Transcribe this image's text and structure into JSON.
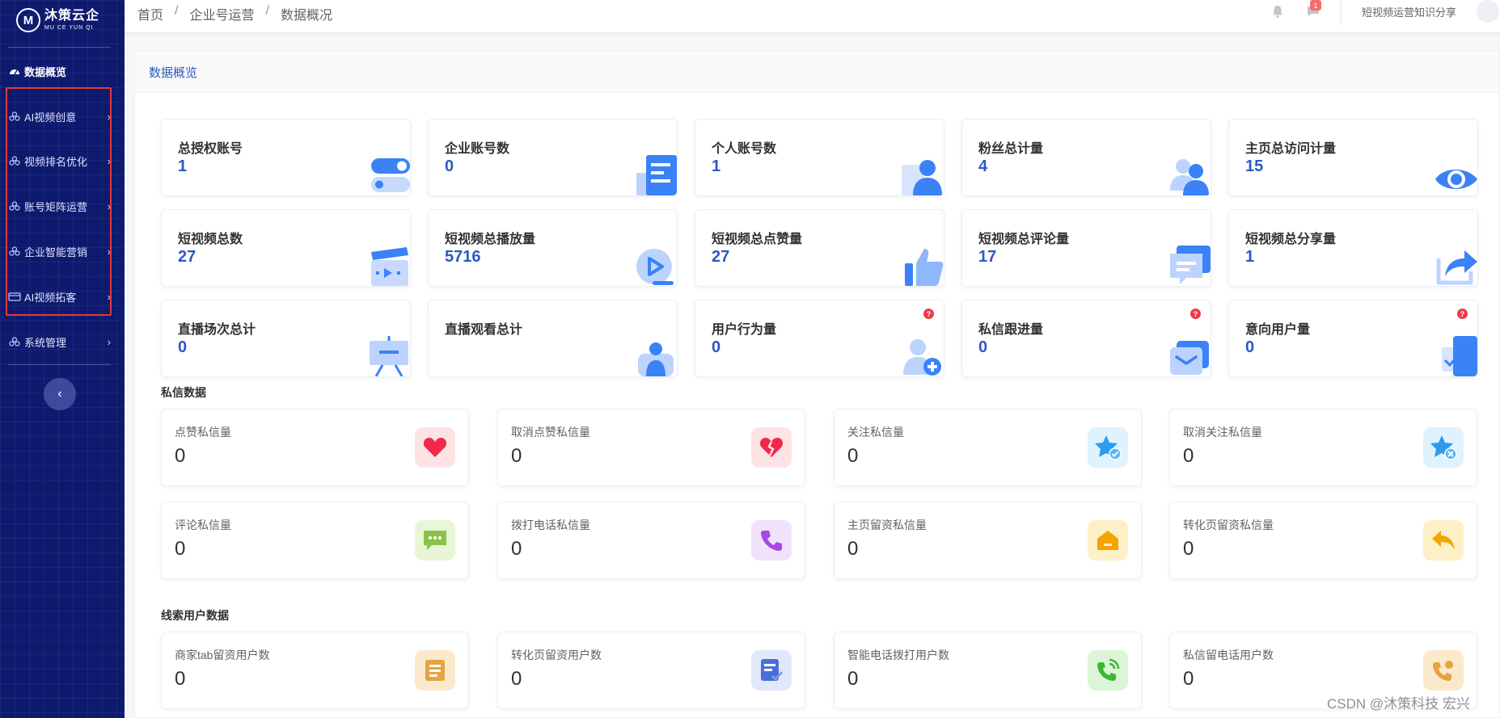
{
  "brand": {
    "cn": "沐策云企",
    "en": "MU CE YUN QI",
    "mark": "M"
  },
  "sidebar": {
    "items": [
      {
        "label": "数据概览"
      },
      {
        "label": "AI视频创意"
      },
      {
        "label": "视频排名优化"
      },
      {
        "label": "账号矩阵运营"
      },
      {
        "label": "企业智能营销"
      },
      {
        "label": "AI视频拓客"
      },
      {
        "label": "系统管理"
      }
    ],
    "collapse_glyph": "‹"
  },
  "header": {
    "breadcrumb": [
      "首页",
      "企业号运营",
      "数据概况"
    ],
    "separator": "/",
    "notification_count": "1",
    "user": "短视频运营知识分享"
  },
  "panel": {
    "title": "数据概览"
  },
  "stats": [
    {
      "label": "总授权账号",
      "value": "1",
      "icon": "toggle-icon"
    },
    {
      "label": "企业账号数",
      "value": "0",
      "icon": "document-icon"
    },
    {
      "label": "个人账号数",
      "value": "1",
      "icon": "user-icon"
    },
    {
      "label": "粉丝总计量",
      "value": "4",
      "icon": "users-icon"
    },
    {
      "label": "主页总访问计量",
      "value": "15",
      "icon": "eye-icon"
    },
    {
      "label": "短视频总数",
      "value": "27",
      "icon": "clapperboard-icon"
    },
    {
      "label": "短视频总播放量",
      "value": "5716",
      "icon": "play-icon"
    },
    {
      "label": "短视频总点赞量",
      "value": "27",
      "icon": "thumbs-up-icon"
    },
    {
      "label": "短视频总评论量",
      "value": "17",
      "icon": "comment-icon"
    },
    {
      "label": "短视频总分享量",
      "value": "1",
      "icon": "share-icon"
    },
    {
      "label": "直播场次总计",
      "value": "0",
      "icon": "easel-icon"
    },
    {
      "label": "直播观看总计",
      "value": "",
      "icon": "viewer-icon"
    },
    {
      "label": "用户行为量",
      "value": "0",
      "icon": "user-add-icon",
      "help": "?"
    },
    {
      "label": "私信跟进量",
      "value": "0",
      "icon": "message-icon",
      "help": "?"
    },
    {
      "label": "意向用户量",
      "value": "0",
      "icon": "checklist-icon",
      "help": "?"
    }
  ],
  "sections": {
    "private_messages": "私信数据",
    "leads": "线索用户数据"
  },
  "private_messages": [
    {
      "label": "点赞私信量",
      "value": "0",
      "icon": "heart-icon",
      "color": "#f0284a",
      "bg": "#fde2e6"
    },
    {
      "label": "取消点赞私信量",
      "value": "0",
      "icon": "broken-heart-icon",
      "color": "#f0284a",
      "bg": "#fde2e6"
    },
    {
      "label": "关注私信量",
      "value": "0",
      "icon": "star-check-icon",
      "color": "#2d9cf0",
      "bg": "#dff2fd"
    },
    {
      "label": "取消关注私信量",
      "value": "0",
      "icon": "star-x-icon",
      "color": "#2d9cf0",
      "bg": "#dff2fd"
    },
    {
      "label": "评论私信量",
      "value": "0",
      "icon": "chat-bubble-icon",
      "color": "#8bc34a",
      "bg": "#e9f6d6"
    },
    {
      "label": "拨打电话私信量",
      "value": "0",
      "icon": "phone-icon",
      "color": "#a548e6",
      "bg": "#f0e2fb"
    },
    {
      "label": "主页留资私信量",
      "value": "0",
      "icon": "home-icon",
      "color": "#f4a400",
      "bg": "#fdefc6"
    },
    {
      "label": "转化页留资私信量",
      "value": "0",
      "icon": "reply-icon",
      "color": "#f4a400",
      "bg": "#fdefc6"
    }
  ],
  "leads": [
    {
      "label": "商家tab留资用户数",
      "value": "0",
      "icon": "notes-icon",
      "color": "#e5a440",
      "bg": "#fbe9cc"
    },
    {
      "label": "转化页留资用户数",
      "value": "0",
      "icon": "form-check-icon",
      "color": "#4b6fd8",
      "bg": "#e2e8fb"
    },
    {
      "label": "智能电话拨打用户数",
      "value": "0",
      "icon": "phone-call-icon",
      "color": "#3cb832",
      "bg": "#dcf5d6"
    },
    {
      "label": "私信留电话用户数",
      "value": "0",
      "icon": "phone-person-icon",
      "color": "#e5a440",
      "bg": "#fbe9cc"
    }
  ],
  "watermark": "CSDN @沐策科技 宏兴"
}
